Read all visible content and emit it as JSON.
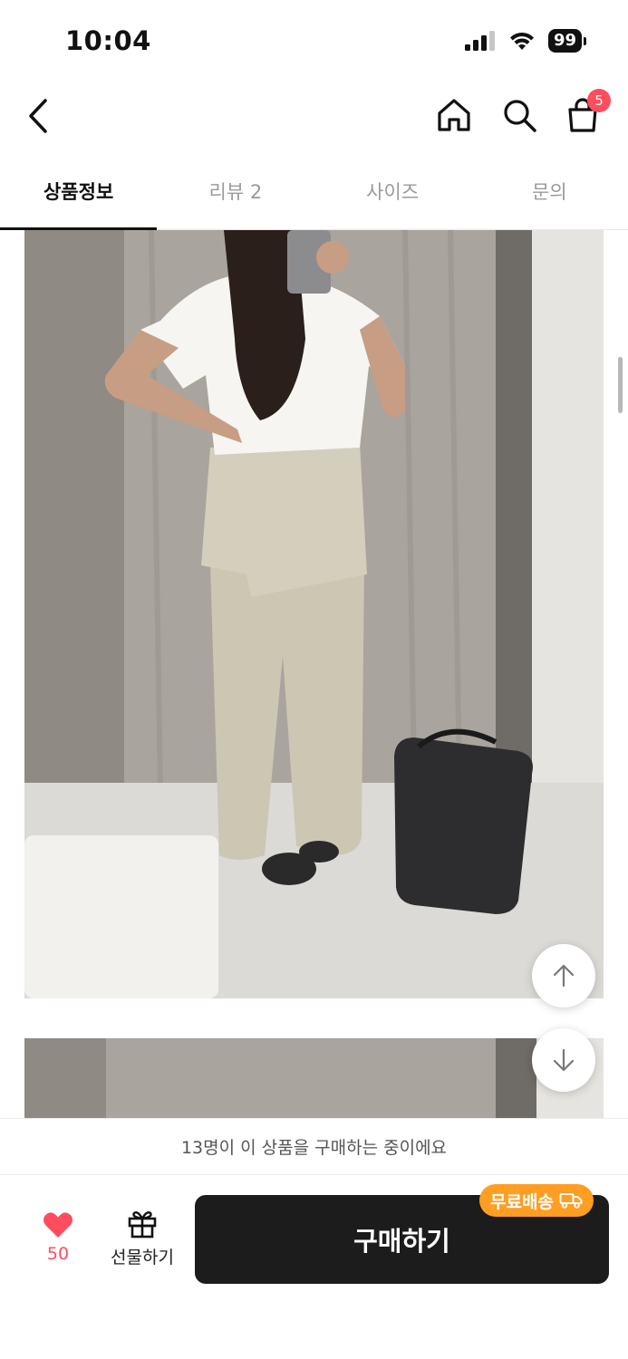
{
  "status_bar": {
    "time": "10:04",
    "battery": "99"
  },
  "nav": {
    "cart_count": "5"
  },
  "tabs": [
    {
      "label": "상품정보",
      "active": true
    },
    {
      "label": "리뷰 2",
      "active": false
    },
    {
      "label": "사이즈",
      "active": false
    },
    {
      "label": "문의",
      "active": false
    }
  ],
  "content": {
    "photos": [
      "product-photo-1",
      "product-photo-2"
    ]
  },
  "social_proof": "13명이 이 상품을 구매하는 중이에요",
  "action_bar": {
    "like_count": "50",
    "gift_label": "선물하기",
    "buy_label": "구매하기",
    "free_shipping_badge": "무료배송"
  },
  "colors": {
    "accent_red": "#ff4d5e",
    "badge_orange": "#ff9e22",
    "buy_button": "#1c1c1c"
  }
}
